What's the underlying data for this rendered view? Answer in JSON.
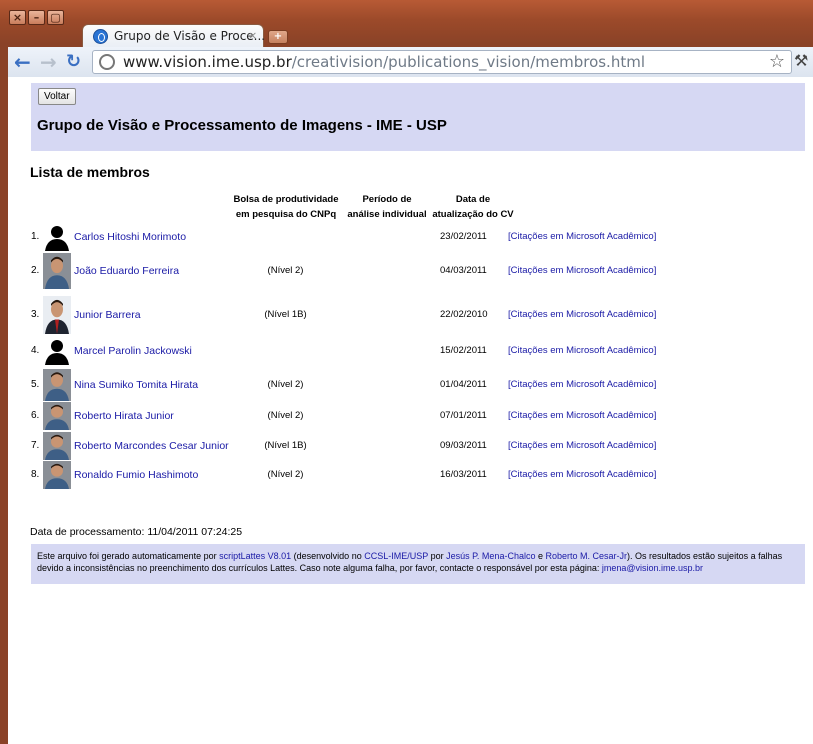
{
  "browser": {
    "tab_title": "Grupo de Visão e Proce...",
    "tab_close": "×",
    "new_tab": "+",
    "url_host": "www.vision.ime.usp.br",
    "url_path": "/creativision/publications_vision/membros.html",
    "window_buttons": [
      "×",
      "–",
      "▢"
    ]
  },
  "header": {
    "back_label": "Voltar",
    "site_title": "Grupo de Visão e Processamento de Imagens - IME - USP"
  },
  "list_title": "Lista de membros",
  "columns": {
    "grant_line1": "Bolsa de produtividade",
    "grant_line2": "em pesquisa do CNPq",
    "period_line1": "Período de",
    "period_line2": "análise individual",
    "date_line1": "Data de",
    "date_line2": "atualização do CV"
  },
  "members": [
    {
      "index": "1.",
      "name": "Carlos Hitoshi Morimoto",
      "level": "",
      "date": "23/02/2011",
      "citation": "[Citações em Microsoft Acadêmico]",
      "photo": "silhouette"
    },
    {
      "index": "2.",
      "name": "João Eduardo Ferreira",
      "level": "(Nível 2)",
      "date": "04/03/2011",
      "citation": "[Citações em Microsoft Acadêmico]",
      "photo": "portrait"
    },
    {
      "index": "3.",
      "name": "Junior Barrera",
      "level": "(Nível 1B)",
      "date": "22/02/2010",
      "citation": "[Citações em Microsoft Acadêmico]",
      "photo": "portrait-suit"
    },
    {
      "index": "4.",
      "name": "Marcel Parolin Jackowski",
      "level": "",
      "date": "15/02/2011",
      "citation": "[Citações em Microsoft Acadêmico]",
      "photo": "silhouette"
    },
    {
      "index": "5.",
      "name": "Nina Sumiko Tomita Hirata",
      "level": "(Nível 2)",
      "date": "01/04/2011",
      "citation": "[Citações em Microsoft Acadêmico]",
      "photo": "portrait"
    },
    {
      "index": "6.",
      "name": "Roberto Hirata Junior",
      "level": "(Nível 2)",
      "date": "07/01/2011",
      "citation": "[Citações em Microsoft Acadêmico]",
      "photo": "portrait"
    },
    {
      "index": "7.",
      "name": "Roberto Marcondes Cesar Junior",
      "level": "(Nível 1B)",
      "date": "09/03/2011",
      "citation": "[Citações em Microsoft Acadêmico]",
      "photo": "portrait"
    },
    {
      "index": "8.",
      "name": "Ronaldo Fumio Hashimoto",
      "level": "(Nível 2)",
      "date": "16/03/2011",
      "citation": "[Citações em Microsoft Acadêmico]",
      "photo": "portrait"
    }
  ],
  "processing": "Data de processamento: 11/04/2011 07:24:25",
  "footer": {
    "t1": "Este arquivo foi gerado automaticamente por ",
    "l1": "scriptLattes V8.01",
    "t2": " (desenvolvido no ",
    "l2": "CCSL-IME/USP",
    "t3": " por ",
    "l3": "Jesús P. Mena-Chalco",
    "t4": " e ",
    "l4": "Roberto M. Cesar-Jr",
    "t5": "). Os resultados estão sujeitos a falhas devido a inconsistências no preenchimento dos currículos Lattes. Caso note alguma falha, por favor, contacte o responsável por esta página: ",
    "l5": "jmena@vision.ime.usp.br"
  },
  "colors": {
    "header_bg": "#d6d8f3",
    "link": "#1a1aa6",
    "frame": "#9c4a2a"
  }
}
